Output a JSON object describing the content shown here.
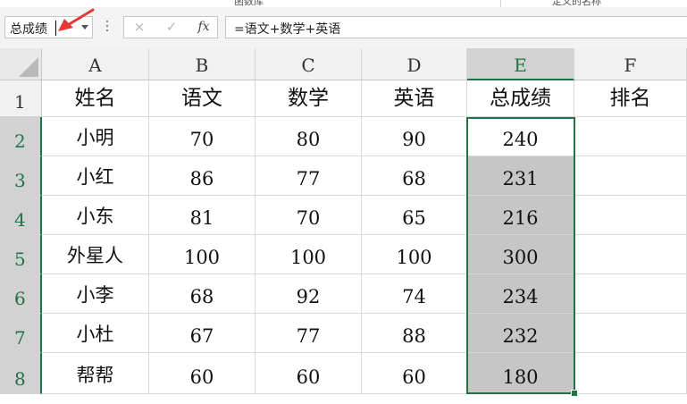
{
  "ribbon": {
    "fragments": [
      "函数库",
      "定义的名称"
    ]
  },
  "formula_bar": {
    "name_box_value": "总成绩",
    "cancel_icon": "×",
    "enter_icon": "✓",
    "fx_label": "fx",
    "formula": "=语文+数学+英语"
  },
  "columns": [
    "A",
    "B",
    "C",
    "D",
    "E",
    "F"
  ],
  "rows": [
    "1",
    "2",
    "3",
    "4",
    "5",
    "6",
    "7",
    "8"
  ],
  "header_row": [
    "姓名",
    "语文",
    "数学",
    "英语",
    "总成绩",
    "排名"
  ],
  "data_rows": [
    [
      "小明",
      "70",
      "80",
      "90",
      "240",
      ""
    ],
    [
      "小红",
      "86",
      "77",
      "68",
      "231",
      ""
    ],
    [
      "小东",
      "81",
      "70",
      "65",
      "216",
      ""
    ],
    [
      "外星人",
      "100",
      "100",
      "100",
      "300",
      ""
    ],
    [
      "小李",
      "68",
      "92",
      "74",
      "234",
      ""
    ],
    [
      "小杜",
      "67",
      "77",
      "88",
      "232",
      ""
    ],
    [
      "帮帮",
      "60",
      "60",
      "60",
      "180",
      ""
    ]
  ],
  "colors": {
    "accent": "#217346",
    "selection_fill": "#c6c6c6",
    "annotation_arrow": "#e53935"
  }
}
